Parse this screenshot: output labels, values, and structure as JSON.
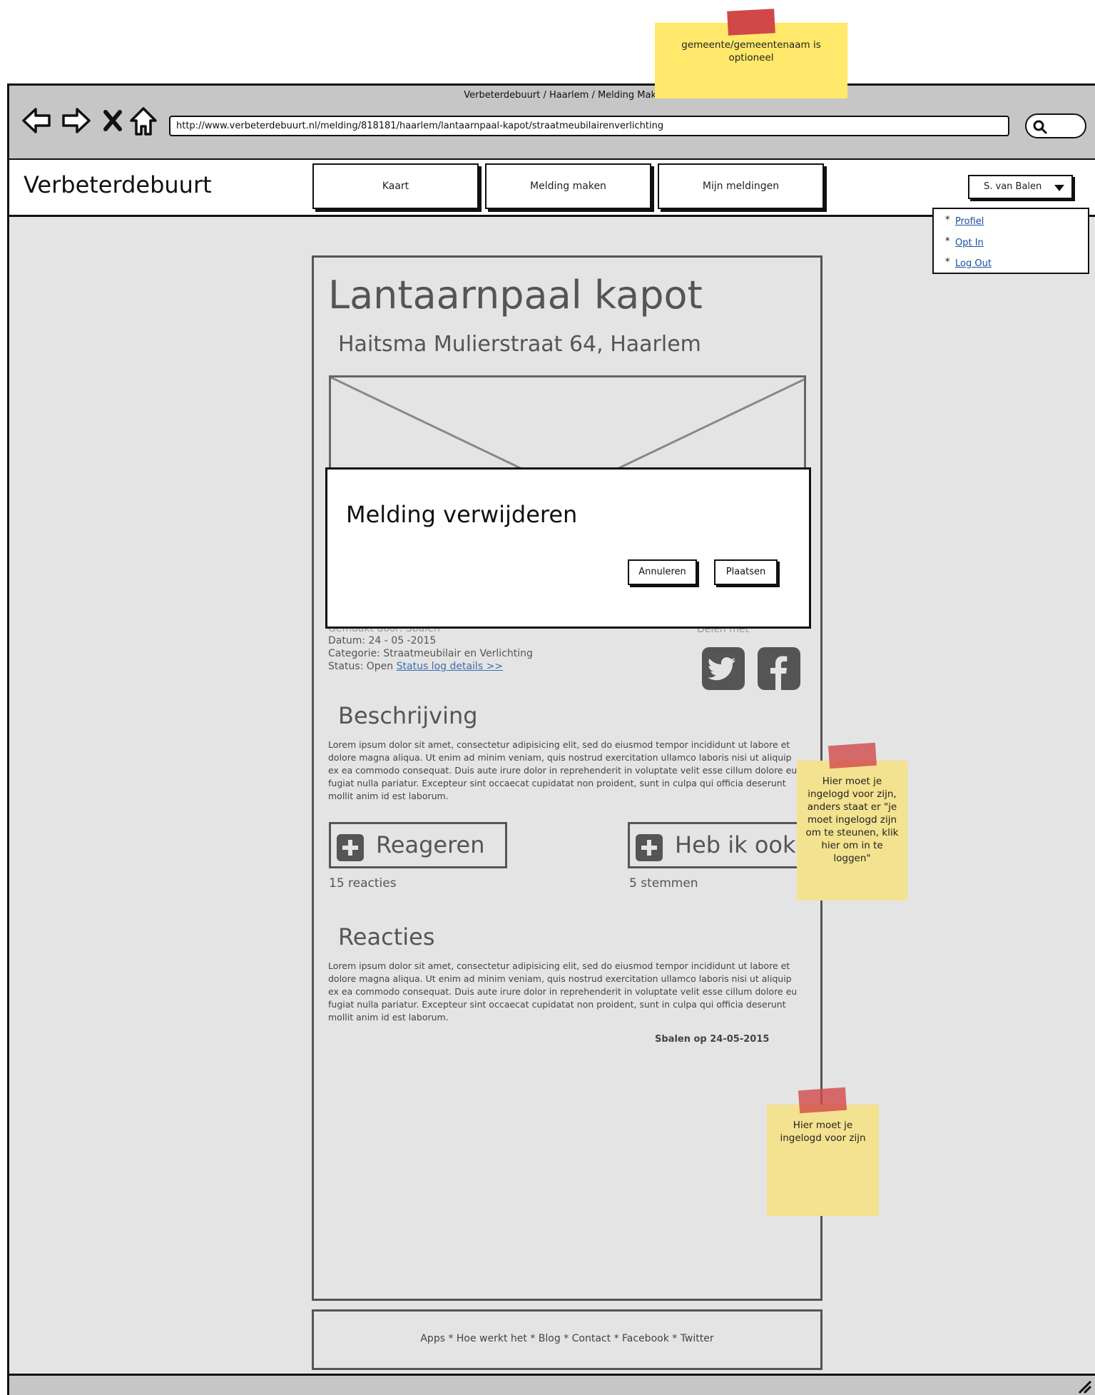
{
  "browser": {
    "window_title": "Verbeterdebuurt / Haarlem / Melding Maken",
    "url": "http://www.verbeterdebuurt.nl/melding/818181/haarlem/lantaarnpaal-kapot/straatmeubilairenverlichting",
    "icons": [
      "back-icon",
      "forward-icon",
      "close-icon",
      "home-icon",
      "search-icon"
    ]
  },
  "header": {
    "logo": "Verbeterdebuurt",
    "nav": [
      {
        "label": "Kaart"
      },
      {
        "label": "Melding maken"
      },
      {
        "label": "Mijn meldingen"
      }
    ],
    "user": {
      "name": "S. van Balen",
      "menu": [
        {
          "label": "Profiel"
        },
        {
          "label": "Opt In"
        },
        {
          "label": "Log Out"
        }
      ]
    }
  },
  "report": {
    "title": "Lantaarnpaal kapot",
    "address": "Haitsma Mulierstraat 64, Haarlem",
    "meta": {
      "gemaakt_door": "Gemaakt door: Sbalen",
      "datum": "Datum: 24 - 05 -2015",
      "categorie": "Categorie: Straatmeubilair en Verlichting",
      "status_prefix": "Status: Open",
      "status_link": "Status log details >>"
    },
    "share_label": "Delen met",
    "beschrijving_heading": "Beschrijving",
    "beschrijving_text": "Lorem ipsum dolor sit amet, consectetur adipisicing elit, sed do eiusmod tempor incididunt ut labore et dolore magna aliqua. Ut enim ad minim veniam, quis nostrud exercitation ullamco laboris nisi ut aliquip ex ea commodo consequat. Duis aute irure dolor in reprehenderit in voluptate velit esse cillum dolore eu fugiat nulla pariatur. Excepteur sint occaecat cupidatat non proident, sunt in culpa qui officia deserunt mollit anim id est laborum.",
    "reageren_label": "Reageren",
    "reacties_count": "15 reacties",
    "hebikook_label": "Heb ik ook",
    "stemmen_count": "5 stemmen",
    "reacties_heading": "Reacties",
    "reacties_text": "Lorem ipsum dolor sit amet, consectetur adipisicing elit, sed do eiusmod tempor incididunt ut labore et dolore magna aliqua. Ut enim ad minim veniam, quis nostrud exercitation ullamco laboris nisi ut aliquip ex ea commodo consequat. Duis aute irure dolor in reprehenderit in voluptate velit esse cillum dolore eu fugiat nulla pariatur. Excepteur sint occaecat cupidatat non proident, sunt in culpa qui officia deserunt mollit anim id est laborum.",
    "reactie_signature": "Sbalen op 24-05-2015"
  },
  "footer": {
    "links": "Apps * Hoe werkt het * Blog * Contact * Facebook * Twitter"
  },
  "modal": {
    "title": "Melding verwijderen",
    "cancel_label": "Annuleren",
    "confirm_label": "Plaatsen"
  },
  "notes": {
    "gemeente": "gemeente/gemeentenaam is optioneel",
    "ingelogd_steunen": "Hier moet je ingelogd voor zijn, anders staat er \"je moet ingelogd zijn om te steunen, klik hier om in te loggen\"",
    "ingelogd": "Hier moet je ingelogd voor zijn"
  },
  "colors": {
    "sticky": "#ffe86a",
    "tape": "#d14848",
    "link": "#3a6fb0",
    "chrome": "#c6c6c6",
    "canvas": "#e4e4e4"
  }
}
